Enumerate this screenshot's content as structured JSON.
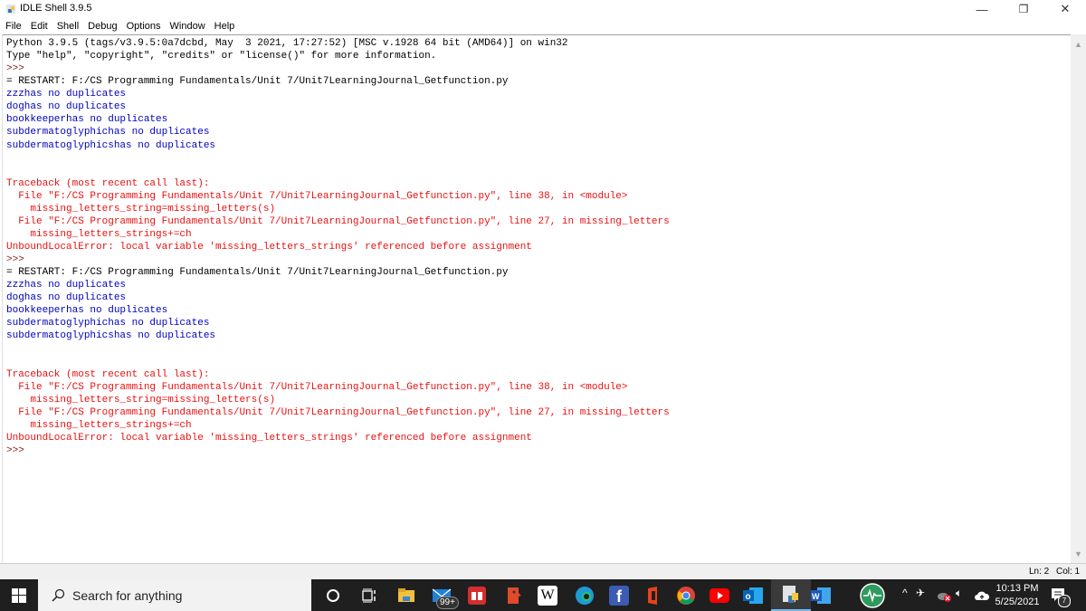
{
  "window": {
    "title": "IDLE Shell 3.9.5",
    "controls": {
      "minimize": "—",
      "restore": "❐",
      "close": "✕"
    }
  },
  "menu": [
    "File",
    "Edit",
    "Shell",
    "Debug",
    "Options",
    "Window",
    "Help"
  ],
  "shell": {
    "lines": [
      {
        "kind": "normal",
        "text": "Python 3.9.5 (tags/v3.9.5:0a7dcbd, May  3 2021, 17:27:52) [MSC v.1928 64 bit (AMD64)] on win32"
      },
      {
        "kind": "normal",
        "text": "Type \"help\", \"copyright\", \"credits\" or \"license()\" for more information."
      },
      {
        "kind": "prompt",
        "text": ">>>"
      },
      {
        "kind": "normal",
        "text": "= RESTART: F:/CS Programming Fundamentals/Unit 7/Unit7LearningJournal_Getfunction.py"
      },
      {
        "kind": "out",
        "text": "zzzhas no duplicates"
      },
      {
        "kind": "out",
        "text": "doghas no duplicates"
      },
      {
        "kind": "out",
        "text": "bookkeeperhas no duplicates"
      },
      {
        "kind": "out",
        "text": "subdermatoglyphichas no duplicates"
      },
      {
        "kind": "out",
        "text": "subdermatoglyphicshas no duplicates"
      },
      {
        "kind": "out",
        "text": ""
      },
      {
        "kind": "out",
        "text": ""
      },
      {
        "kind": "err",
        "text": "Traceback (most recent call last):"
      },
      {
        "kind": "err",
        "text": "  File \"F:/CS Programming Fundamentals/Unit 7/Unit7LearningJournal_Getfunction.py\", line 38, in <module>"
      },
      {
        "kind": "err",
        "text": "    missing_letters_string=missing_letters(s)"
      },
      {
        "kind": "err",
        "text": "  File \"F:/CS Programming Fundamentals/Unit 7/Unit7LearningJournal_Getfunction.py\", line 27, in missing_letters"
      },
      {
        "kind": "err",
        "text": "    missing_letters_strings+=ch"
      },
      {
        "kind": "err",
        "text": "UnboundLocalError: local variable 'missing_letters_strings' referenced before assignment"
      },
      {
        "kind": "prompt",
        "text": ">>>"
      },
      {
        "kind": "normal",
        "text": "= RESTART: F:/CS Programming Fundamentals/Unit 7/Unit7LearningJournal_Getfunction.py"
      },
      {
        "kind": "out",
        "text": "zzzhas no duplicates"
      },
      {
        "kind": "out",
        "text": "doghas no duplicates"
      },
      {
        "kind": "out",
        "text": "bookkeeperhas no duplicates"
      },
      {
        "kind": "out",
        "text": "subdermatoglyphichas no duplicates"
      },
      {
        "kind": "out",
        "text": "subdermatoglyphicshas no duplicates"
      },
      {
        "kind": "out",
        "text": ""
      },
      {
        "kind": "out",
        "text": ""
      },
      {
        "kind": "err",
        "text": "Traceback (most recent call last):"
      },
      {
        "kind": "err",
        "text": "  File \"F:/CS Programming Fundamentals/Unit 7/Unit7LearningJournal_Getfunction.py\", line 38, in <module>"
      },
      {
        "kind": "err",
        "text": "    missing_letters_string=missing_letters(s)"
      },
      {
        "kind": "err",
        "text": "  File \"F:/CS Programming Fundamentals/Unit 7/Unit7LearningJournal_Getfunction.py\", line 27, in missing_letters"
      },
      {
        "kind": "err",
        "text": "    missing_letters_strings+=ch"
      },
      {
        "kind": "err",
        "text": "UnboundLocalError: local variable 'missing_letters_strings' referenced before assignment"
      },
      {
        "kind": "prompt",
        "text": ">>>"
      }
    ]
  },
  "status": {
    "line": "Ln: 2",
    "col": "Col: 1"
  },
  "taskbar": {
    "search_placeholder": "Search for anything",
    "mail_badge": "99+",
    "clock_time": "10:13 PM",
    "clock_date": "5/25/2021",
    "notifications_count": "7"
  },
  "colors": {
    "stdout": "#0000c0",
    "stderr": "#e81010",
    "prompt": "#8b1a1a"
  }
}
